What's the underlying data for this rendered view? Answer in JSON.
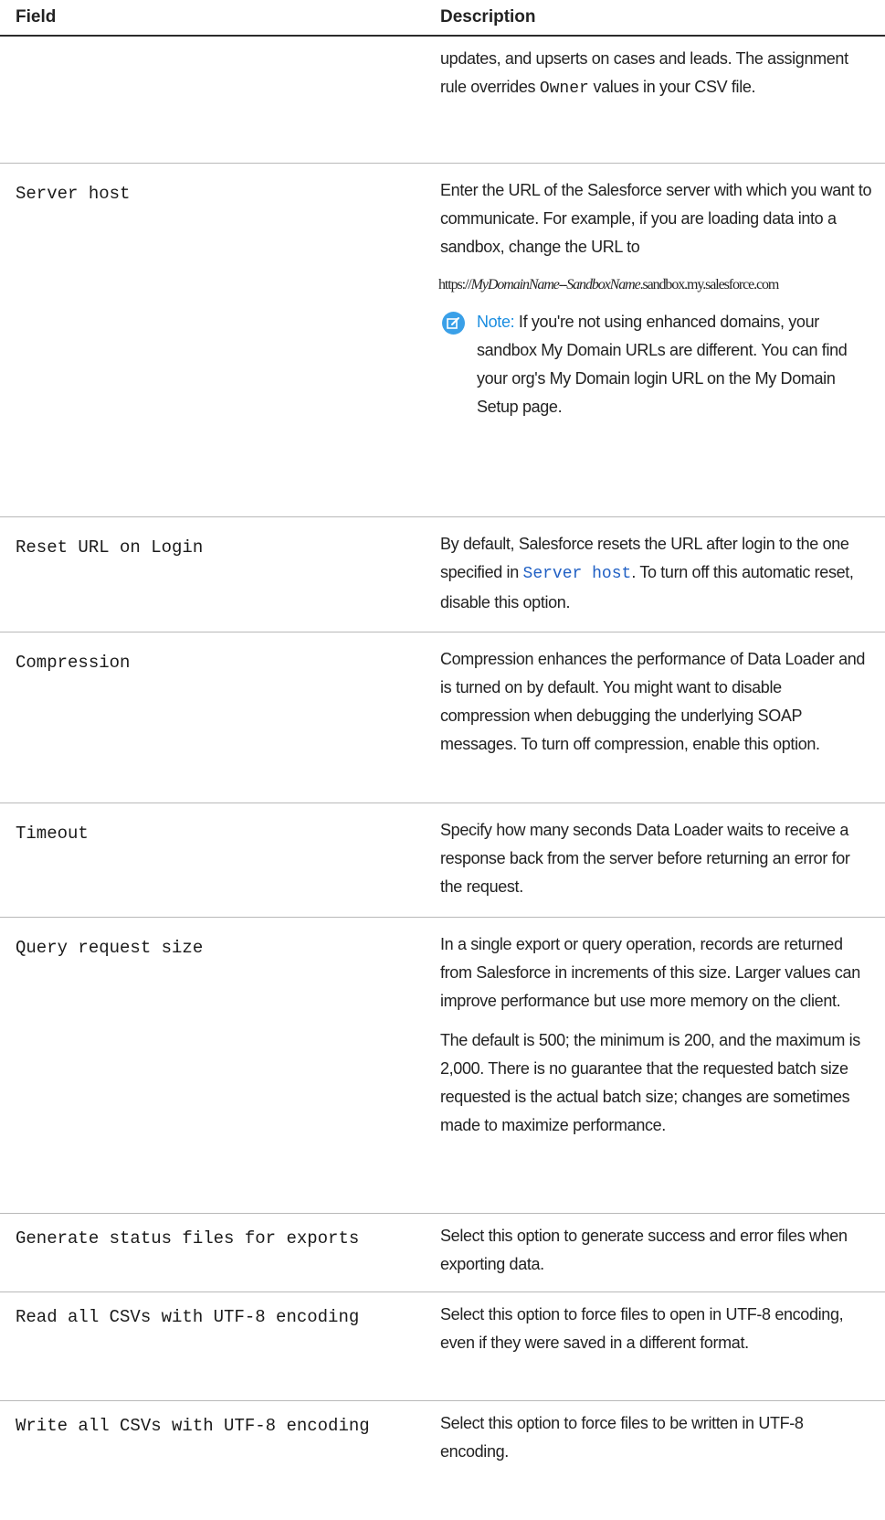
{
  "table": {
    "header_field": "Field",
    "header_description": "Description",
    "row0": {
      "desc_pre": "updates, and upserts on cases and leads. The assignment rule overrides ",
      "desc_code": "Owner",
      "desc_post": " values in your CSV file."
    },
    "row1": {
      "field": "Server host",
      "desc": "Enter the URL of the Salesforce server with which you want to communicate. For example, if you are loading data into a sandbox, change the URL to",
      "url_prefix": "https://",
      "url_domain": "MyDomainName",
      "url_dash": "--",
      "url_sandbox": "SandboxName",
      "url_suffix": ".sandbox.my.salesforce.com",
      "note_label": "Note:",
      "note_text": " If you're not using enhanced domains, your sandbox My Domain URLs are different. You can find your org's My Domain login URL on the My Domain Setup page.",
      "note_icon": "edit-note-icon",
      "note_color": "#3aa0e8"
    },
    "row2": {
      "field": "Reset URL on Login",
      "desc_pre": "By default, Salesforce resets the URL after login to the one specified in ",
      "desc_link": "Server host",
      "desc_post": ". To turn off this automatic reset, disable this option.",
      "link_color": "#1f5fc4"
    },
    "row3": {
      "field": "Compression",
      "desc": "Compression enhances the performance of Data Loader and is turned on by default. You might want to disable compression when debugging the underlying SOAP messages. To turn off compression, enable this option."
    },
    "row4": {
      "field": "Timeout",
      "desc": "Specify how many seconds Data Loader waits to receive a response back from the server before returning an error for the request."
    },
    "row5": {
      "field": "Query request size",
      "desc1": "In a single export or query operation, records are returned from Salesforce in increments of this size. Larger values can improve performance but use more memory on the client.",
      "desc2": "The default is 500; the minimum is 200, and the maximum is 2,000. There is no guarantee that the requested batch size requested is the actual batch size; changes are sometimes made to maximize performance."
    },
    "row6": {
      "field": "Generate status files for exports",
      "desc": "Select this option to generate success and error files when exporting data."
    },
    "row7": {
      "field": "Read all CSVs with UTF-8 encoding",
      "desc": "Select this option to force files to open in UTF-8 encoding, even if they were saved in a different format."
    },
    "row8": {
      "field": "Write all CSVs with UTF-8 encoding",
      "desc": "Select this option to force files to be written in UTF-8 encoding."
    }
  }
}
